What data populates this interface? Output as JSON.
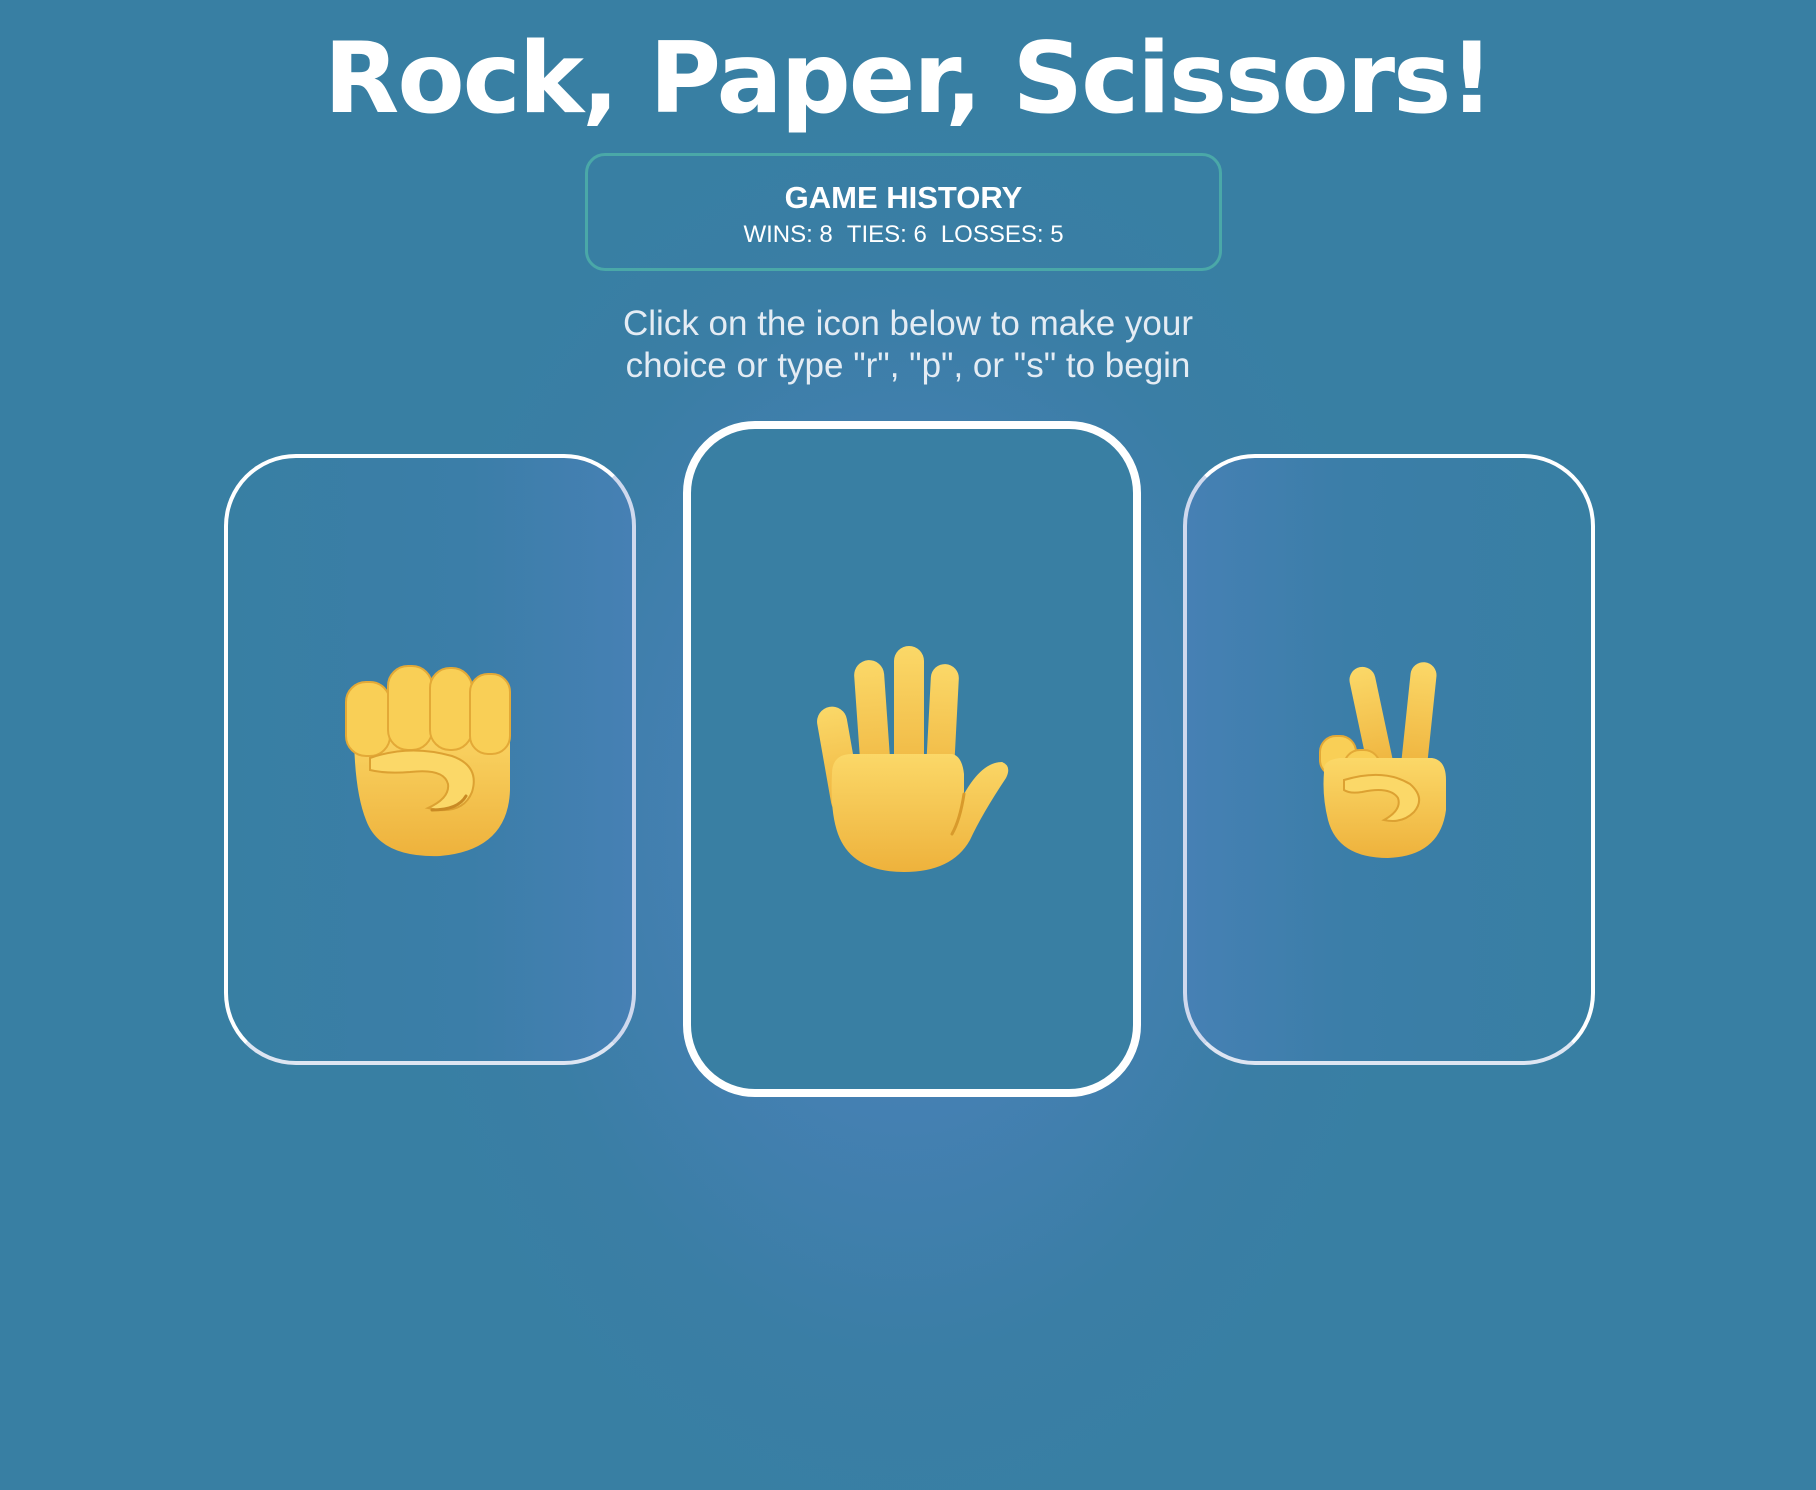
{
  "header": {
    "title": "Rock, Paper, Scissors!"
  },
  "history": {
    "title": "GAME HISTORY",
    "wins_label": "WINS: 8",
    "ties_label": "TIES: 6",
    "losses_label": "LOSSES: 5",
    "wins": 8,
    "ties": 6,
    "losses": 5
  },
  "instructions": {
    "line1": "Click on the icon below to make your",
    "line2": "choice or type \"r\", \"p\", or \"s\" to begin"
  },
  "choices": [
    {
      "name": "rock",
      "icon": "raised-fist-icon",
      "key": "r"
    },
    {
      "name": "paper",
      "icon": "raised-hand-icon",
      "key": "p"
    },
    {
      "name": "scissors",
      "icon": "victory-hand-icon",
      "key": "s"
    }
  ],
  "colors": {
    "background": "#387fa3",
    "background_glow": "#4e86bd",
    "history_border": "#4aa8a8",
    "card_border": "#ffffff",
    "hand_fill": "#f7c84a",
    "hand_shadow": "#e0a42a"
  }
}
